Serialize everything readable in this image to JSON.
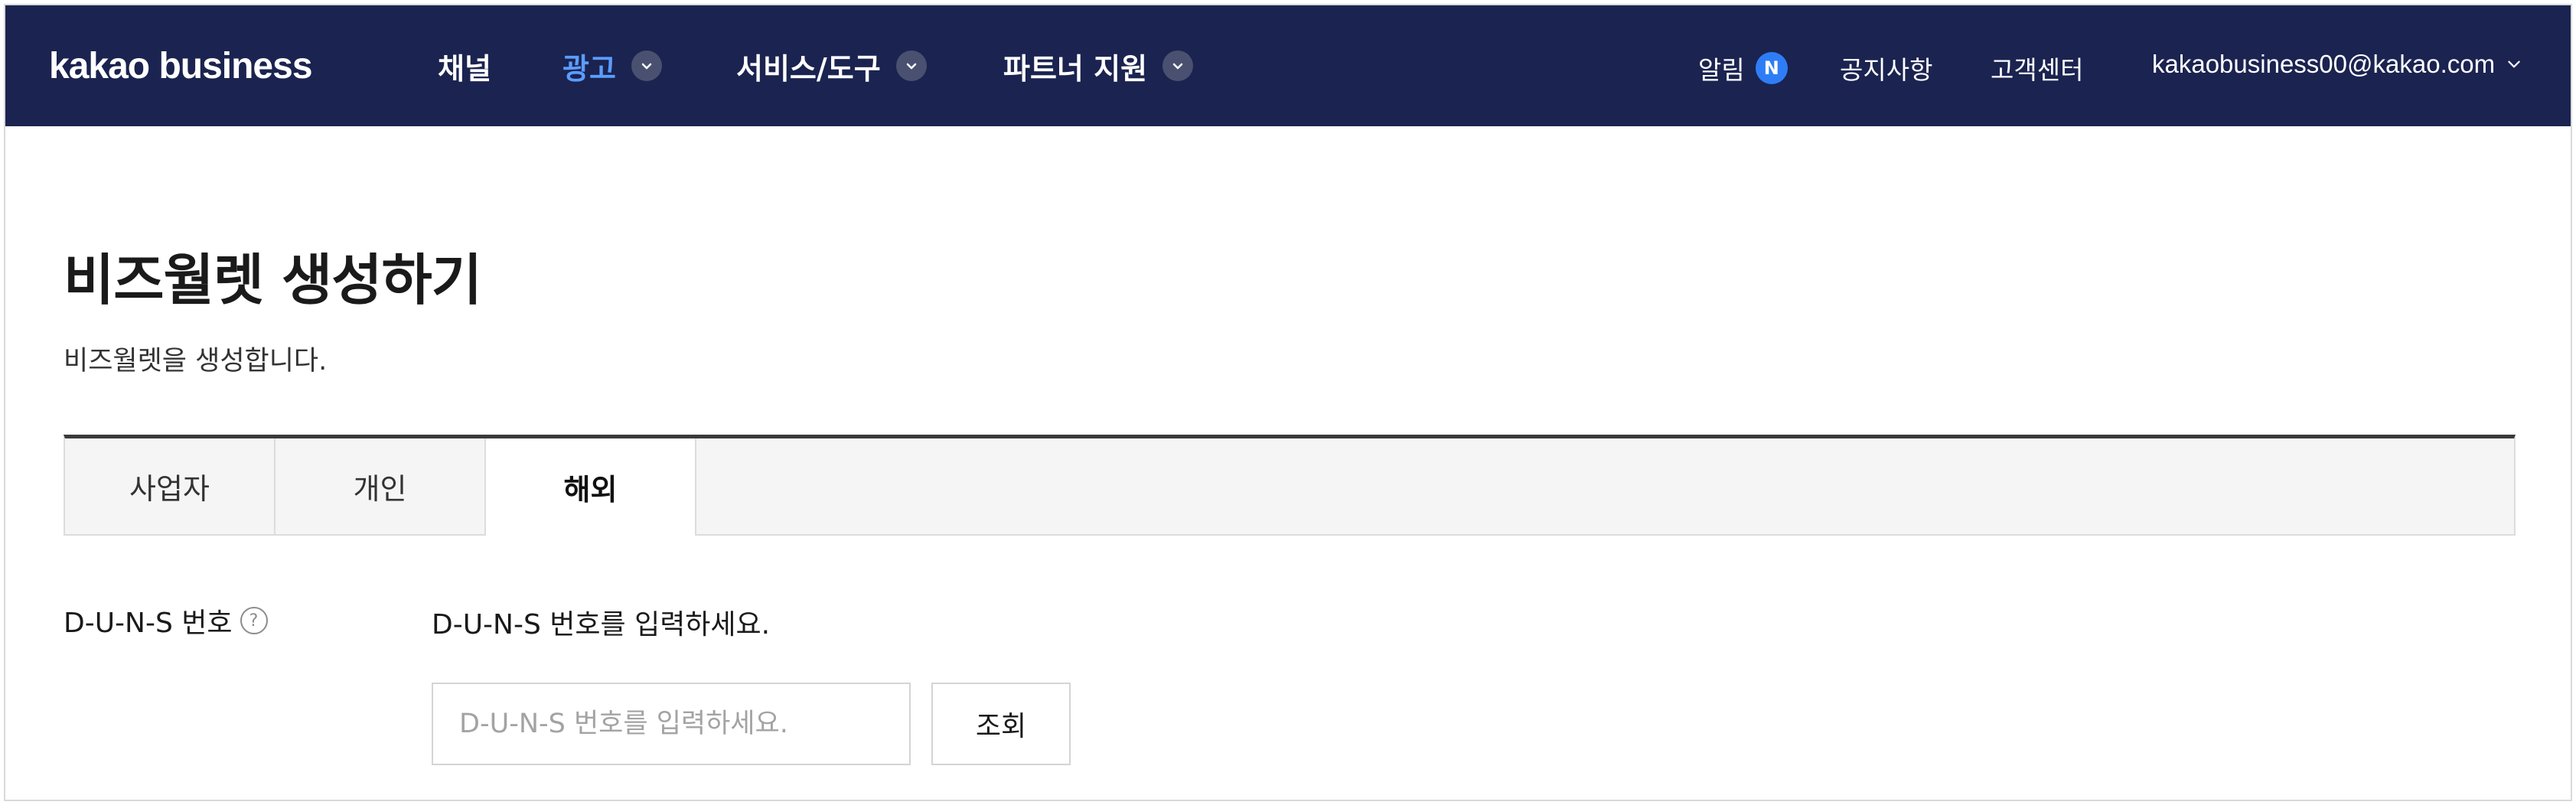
{
  "header": {
    "logo": "kakao business",
    "nav": [
      {
        "label": "채널",
        "active": false,
        "has_dropdown": false
      },
      {
        "label": "광고",
        "active": true,
        "has_dropdown": true
      },
      {
        "label": "서비스/도구",
        "active": false,
        "has_dropdown": true
      },
      {
        "label": "파트너 지원",
        "active": false,
        "has_dropdown": true
      }
    ],
    "util": {
      "notifications": "알림",
      "notifications_badge": "N",
      "notices": "공지사항",
      "support": "고객센터",
      "account": "kakaobusiness00@kakao.com"
    },
    "colors": {
      "bar": "#1b2350",
      "active": "#5b9dff",
      "badge": "#2f7df6"
    }
  },
  "page": {
    "title": "비즈월렛 생성하기",
    "description": "비즈월렛을 생성합니다."
  },
  "tabs": [
    {
      "label": "사업자",
      "selected": false
    },
    {
      "label": "개인",
      "selected": false
    },
    {
      "label": "해외",
      "selected": true
    }
  ],
  "form": {
    "duns_label": "D-U-N-S 번호",
    "help_glyph": "?",
    "duns_guide": "D-U-N-S 번호를 입력하세요.",
    "duns_placeholder": "D-U-N-S 번호를 입력하세요.",
    "duns_value": "",
    "lookup_button": "조회"
  }
}
